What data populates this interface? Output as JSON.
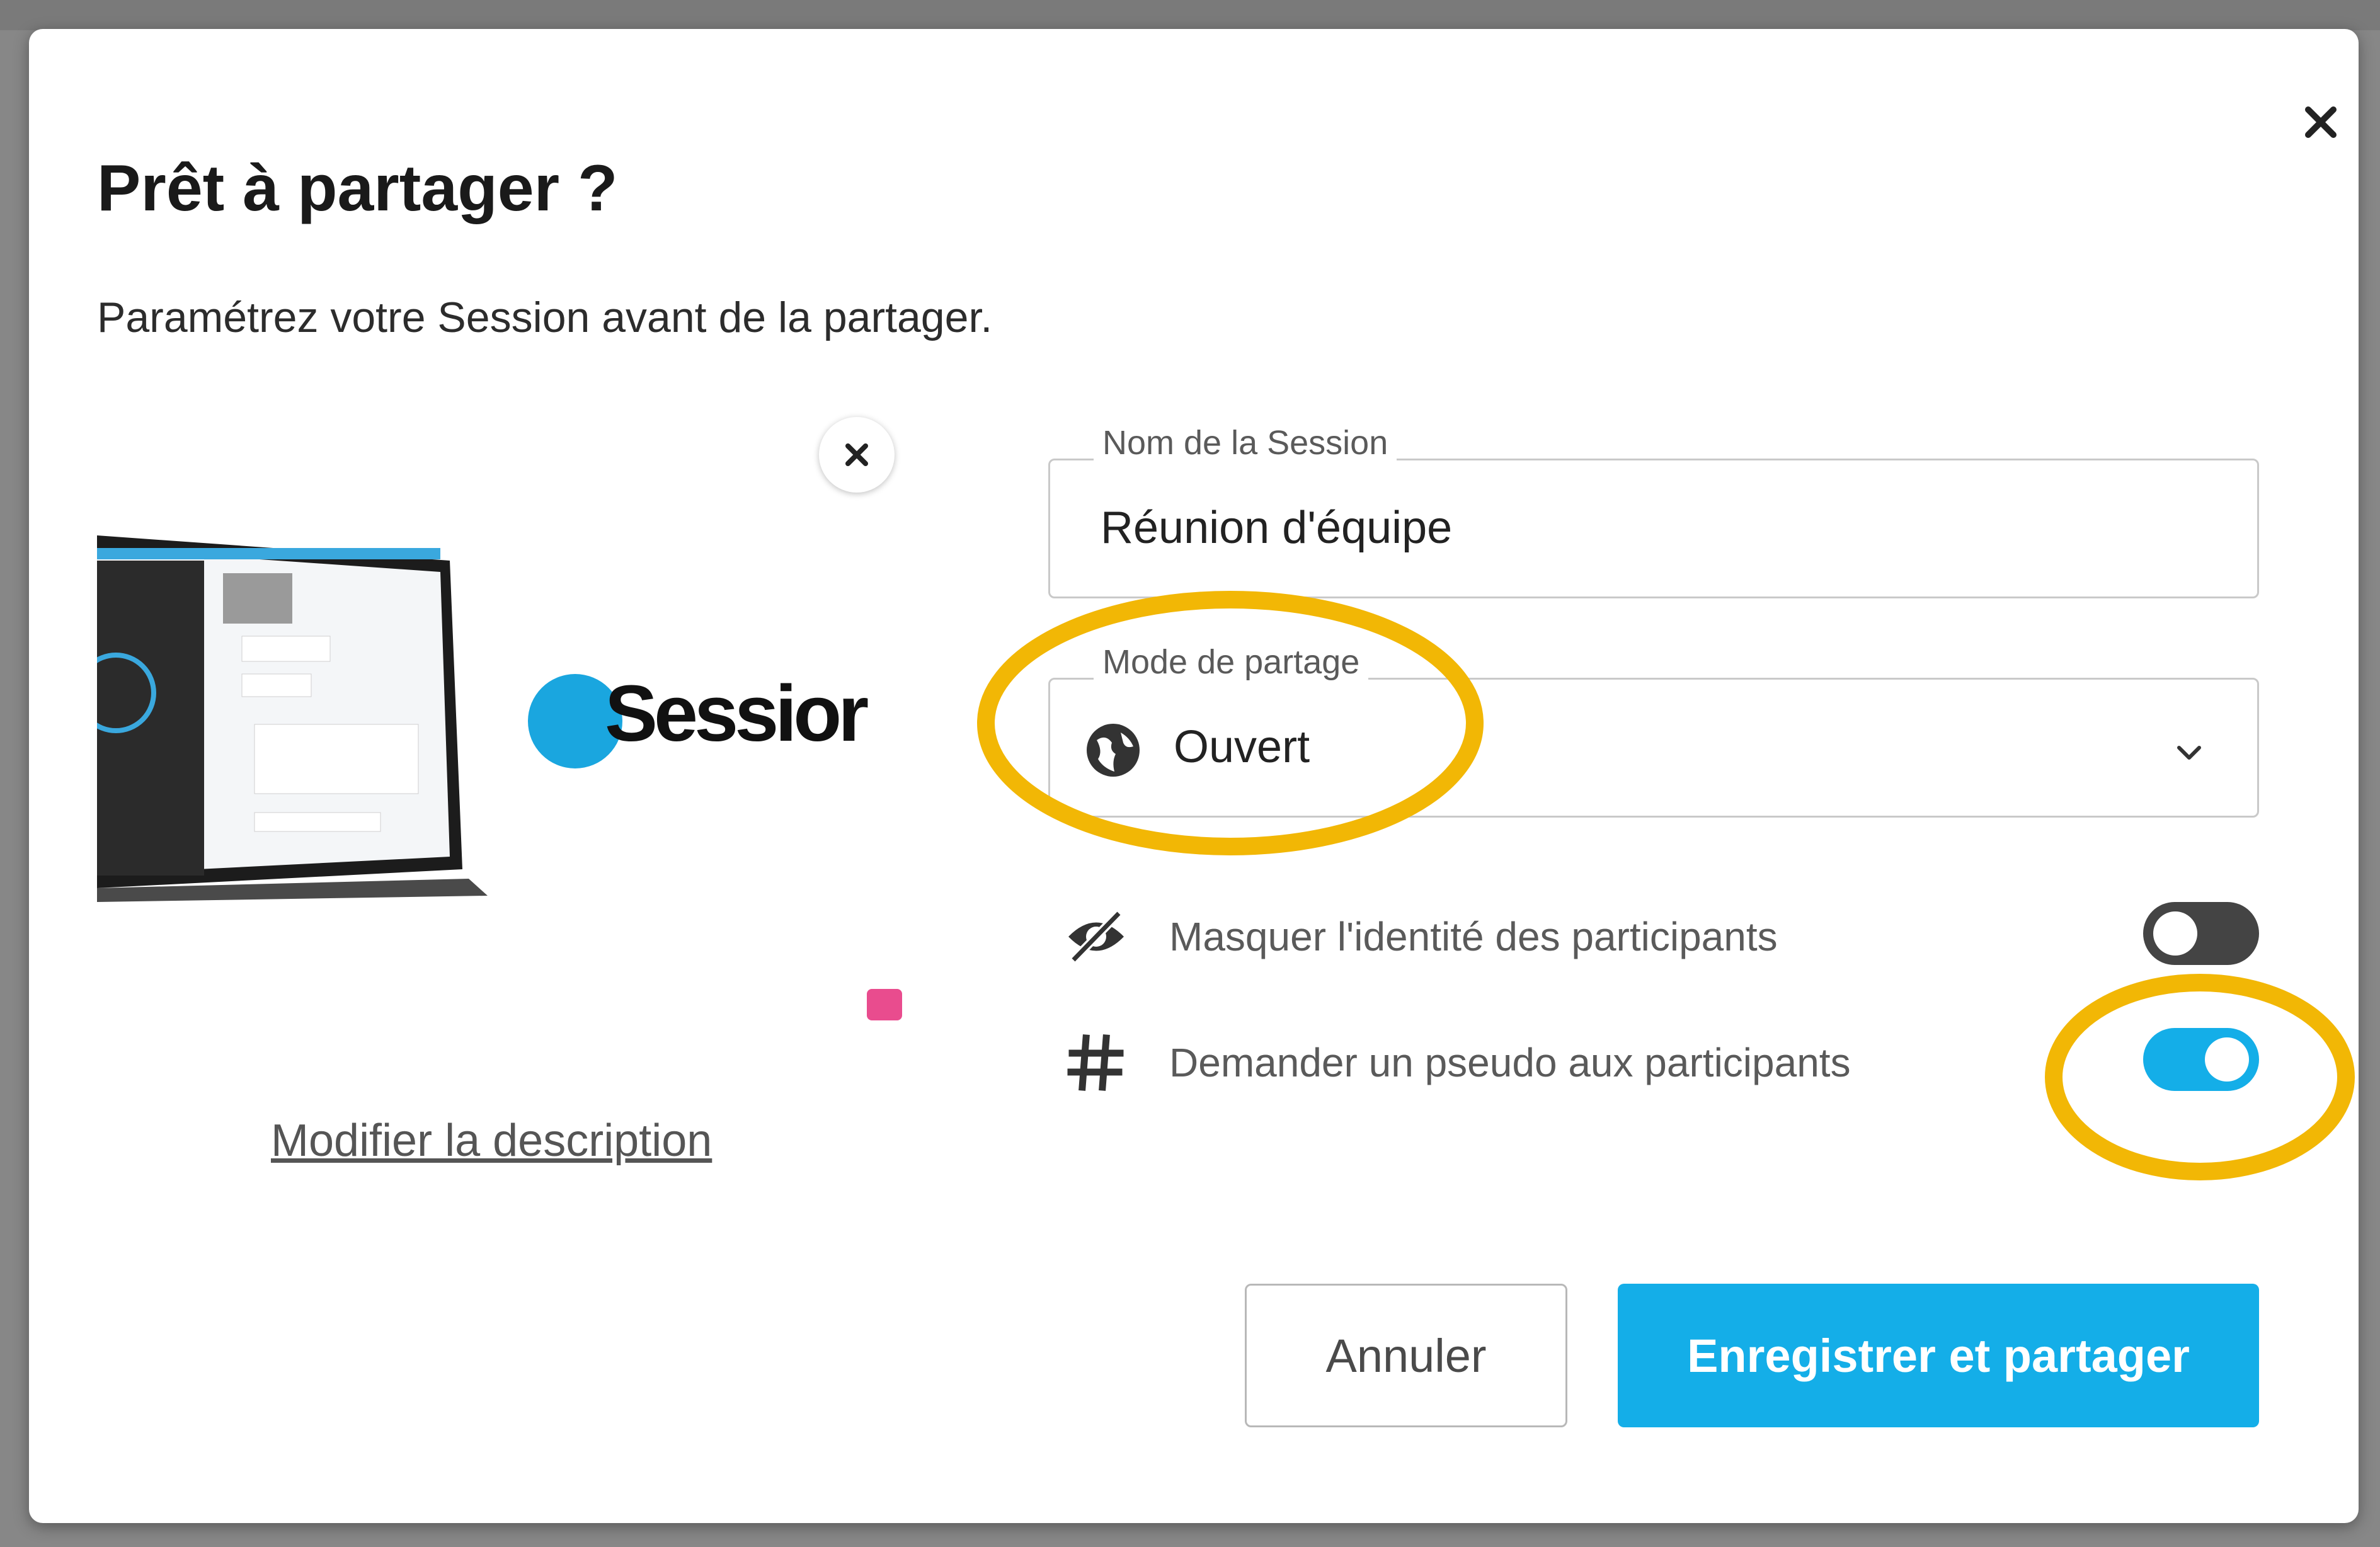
{
  "dialog": {
    "title": "Prêt à partager ?",
    "subtitle": "Paramétrez votre Session avant de la partager."
  },
  "preview": {
    "logo_text": "Sessior",
    "modify_link": "Modifier la description"
  },
  "form": {
    "name_field": {
      "label": "Nom de la Session",
      "value": "Réunion d'équipe"
    },
    "mode_field": {
      "label": "Mode de partage",
      "value": "Ouvert",
      "icon": "globe-icon"
    },
    "options": [
      {
        "label": "Masquer l'identité des participants",
        "icon": "eye-off-icon",
        "enabled": false
      },
      {
        "label": "Demander un pseudo aux participants",
        "icon": "hashtag-icon",
        "enabled": true
      }
    ]
  },
  "actions": {
    "cancel_label": "Annuler",
    "submit_label": "Enregistrer et partager"
  },
  "colors": {
    "accent": "#14aee8",
    "annotation": "#f2b705",
    "toggle_off": "#444444"
  }
}
